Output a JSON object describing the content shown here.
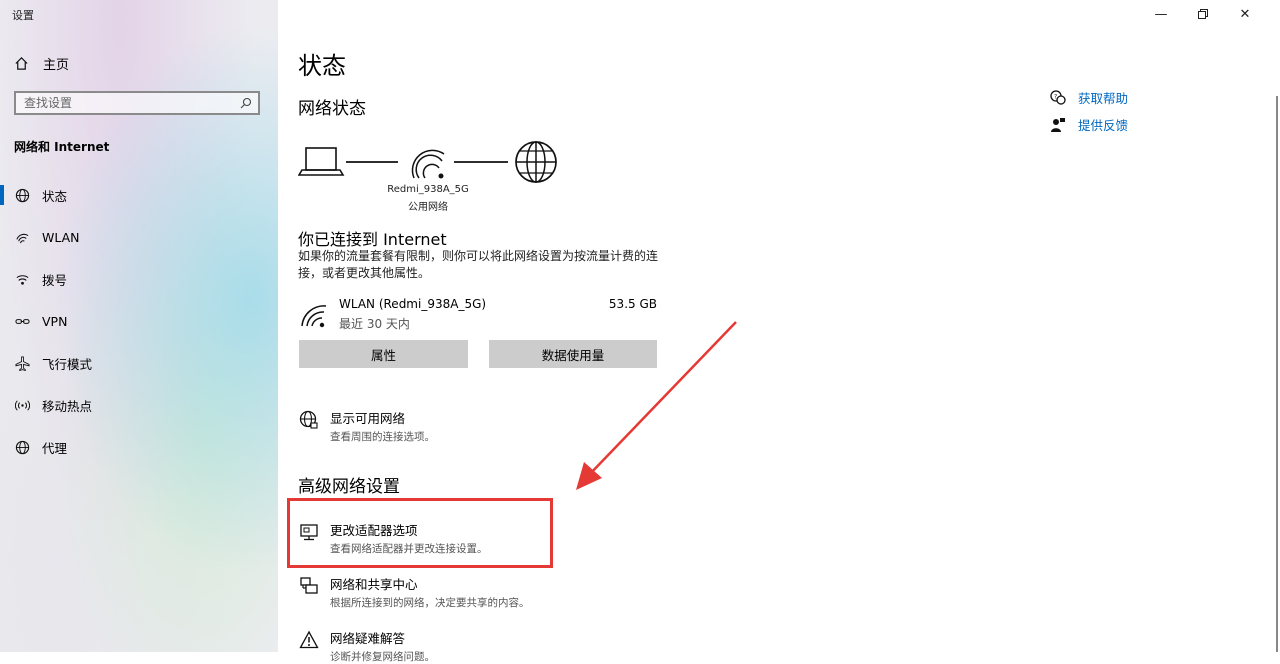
{
  "window": {
    "title": "设置",
    "minimize": "—",
    "close": "✕"
  },
  "sidebar": {
    "home_label": "主页",
    "search_placeholder": "查找设置",
    "section": "网络和 Internet",
    "items": [
      {
        "label": "状态",
        "icon": "status-globe-icon",
        "active": true
      },
      {
        "label": "WLAN",
        "icon": "wifi-icon",
        "active": false
      },
      {
        "label": "拨号",
        "icon": "dialup-icon",
        "active": false
      },
      {
        "label": "VPN",
        "icon": "vpn-icon",
        "active": false
      },
      {
        "label": "飞行模式",
        "icon": "airplane-icon",
        "active": false
      },
      {
        "label": "移动热点",
        "icon": "hotspot-icon",
        "active": false
      },
      {
        "label": "代理",
        "icon": "proxy-globe-icon",
        "active": false
      }
    ]
  },
  "main": {
    "title": "状态",
    "network_status": "网络状态",
    "diagram": {
      "network_name": "Redmi_938A_5G",
      "network_type": "公用网络"
    },
    "connected_title": "你已连接到 Internet",
    "connected_desc": "如果你的流量套餐有限制，则你可以将此网络设置为按流量计费的连接，或者更改其他属性。",
    "connection": {
      "name": "WLAN (Redmi_938A_5G)",
      "period": "最近 30 天内",
      "usage": "53.5 GB"
    },
    "buttons": {
      "properties": "属性",
      "data_usage": "数据使用量"
    },
    "show_networks": {
      "title": "显示可用网络",
      "subtitle": "查看周围的连接选项。"
    },
    "advanced_title": "高级网络设置",
    "advanced_items": [
      {
        "title": "更改适配器选项",
        "subtitle": "查看网络适配器并更改连接设置。",
        "icon": "adapter-monitor-icon"
      },
      {
        "title": "网络和共享中心",
        "subtitle": "根据所连接到的网络，决定要共享的内容。",
        "icon": "sharing-center-icon"
      },
      {
        "title": "网络疑难解答",
        "subtitle": "诊断并修复网络问题。",
        "icon": "warning-icon"
      }
    ]
  },
  "help": {
    "get_help": "获取帮助",
    "feedback": "提供反馈"
  },
  "colors": {
    "accent": "#0067c0",
    "highlight": "#e53935",
    "button_bg": "#cccccc"
  }
}
